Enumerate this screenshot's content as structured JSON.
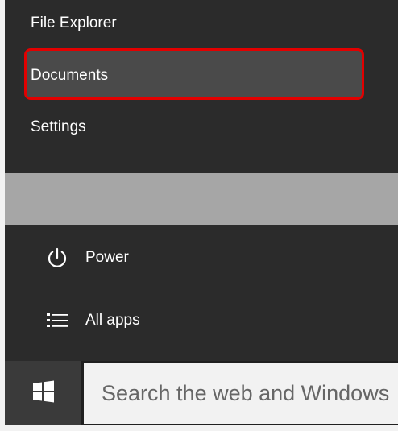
{
  "start_menu": {
    "items": [
      {
        "label": "File Explorer"
      },
      {
        "label": "Documents"
      },
      {
        "label": "Settings"
      }
    ],
    "selected_item": "Documents",
    "highlight_color": "#e20000"
  },
  "power": {
    "label": "Power",
    "icon": "power-icon"
  },
  "all_apps": {
    "label": "All apps",
    "icon": "list-icon"
  },
  "taskbar": {
    "start_icon": "windows-logo-icon",
    "search": {
      "placeholder": "Search the web and Windows"
    }
  },
  "colors": {
    "menu_background": "#2b2b2b",
    "gray_band": "#a6a6a6",
    "taskbar_background": "#202020",
    "search_background": "#f2f2f2"
  }
}
